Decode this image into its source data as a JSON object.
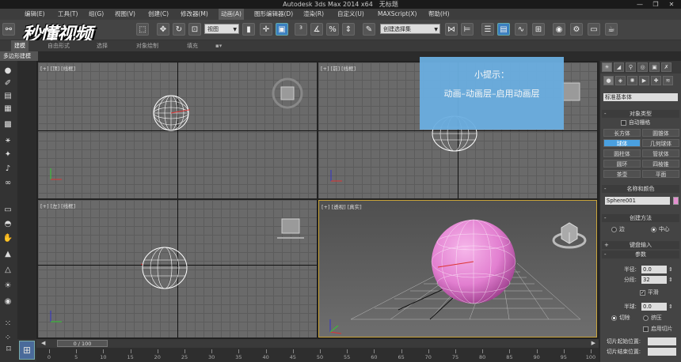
{
  "titlebar": {
    "app": "Autodesk 3ds Max  2014 x64",
    "doc": "无标题"
  },
  "menu": [
    "编辑(E)",
    "工具(T)",
    "组(G)",
    "视图(V)",
    "创建(C)",
    "修改器(M)",
    "动画(A)",
    "图形编辑器(D)",
    "渲染(R)",
    "自定义(U)",
    "MAXScript(X)",
    "帮助(H)"
  ],
  "toolbar": {
    "view_dropdown": "视图",
    "selection_set_dropdown": "创建选择集"
  },
  "watermark": "秒懂视频",
  "ribbon": {
    "tabs": [
      "建模",
      "自由形式",
      "选择",
      "对象绘制",
      "填充"
    ],
    "subbar": "多边形建模"
  },
  "viewports": {
    "top": {
      "plus": "[+]",
      "name": "[顶]",
      "shade": "[线框]"
    },
    "front": {
      "plus": "[+]",
      "name": "[前]",
      "shade": "[线框]"
    },
    "left": {
      "plus": "[+]",
      "name": "[左]",
      "shade": "[线框]"
    },
    "persp": {
      "plus": "[+]",
      "name": "[透视]",
      "shade": "[真实]"
    }
  },
  "tip": {
    "title": "小提示：",
    "body": "动画–动画层–启用动画层"
  },
  "panel": {
    "category": "标准基本体",
    "object_type_header": "对象类型",
    "autogrid": "自动栅格",
    "buttons": [
      [
        "长方体",
        "圆锥体"
      ],
      [
        "球体",
        "几何球体"
      ],
      [
        "圆柱体",
        "管状体"
      ],
      [
        "圆环",
        "四棱锥"
      ],
      [
        "茶壶",
        "平面"
      ]
    ],
    "name_color_header": "名称和颜色",
    "object_name": "Sphere001",
    "creation_method_header": "创建方法",
    "edge": "边",
    "center": "中心",
    "keyboard_header": "键盘输入",
    "params_header": "参数",
    "radius_label": "半径:",
    "radius_value": "0.0",
    "segments_label": "分段:",
    "segments_value": "32",
    "smooth": "平滑",
    "hemisphere_label": "半球:",
    "hemisphere_value": "0.0",
    "chop": "切除",
    "squash": "挤压",
    "enable_slice": "启用切片",
    "slice_from_label": "切片起始位置:",
    "slice_to_label": "切片结束位置:"
  },
  "timeline": {
    "frame_text": "0 / 100",
    "ticks": [
      "0",
      "5",
      "10",
      "15",
      "20",
      "25",
      "30",
      "35",
      "40",
      "45",
      "50",
      "55",
      "60",
      "65",
      "70",
      "75",
      "80",
      "85",
      "90",
      "95",
      "100"
    ]
  },
  "colors": {
    "accent_blue": "#4aa0e0",
    "tip_bg": "#6aaee0",
    "sphere_pink": "#e27fd0",
    "object_color": "#e58fd0"
  }
}
